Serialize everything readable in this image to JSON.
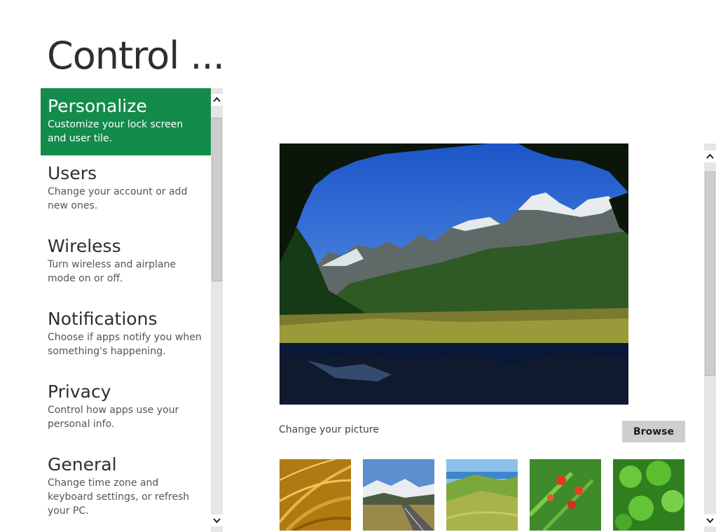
{
  "page": {
    "title": "Control ..."
  },
  "nav": {
    "items": [
      {
        "title": "Personalize",
        "desc": "Customize your lock screen and user tile.",
        "selected": true
      },
      {
        "title": "Users",
        "desc": "Change your account or add new ones."
      },
      {
        "title": "Wireless",
        "desc": "Turn wireless and airplane mode on or off."
      },
      {
        "title": "Notifications",
        "desc": "Choose if apps notify you when something's happening."
      },
      {
        "title": "Privacy",
        "desc": "Control how apps use your personal info."
      },
      {
        "title": "General",
        "desc": "Change time zone and keyboard settings, or refresh your PC."
      }
    ]
  },
  "picture": {
    "change_label": "Change your picture",
    "browse_label": "Browse",
    "thumbnails": [
      "golden-grass",
      "mountain-road",
      "coastal-hills",
      "red-flowers",
      "green-clover"
    ]
  },
  "colors": {
    "accent": "#138b4b",
    "scrollbar_track": "#e6e6e6",
    "button": "#cfcfcf"
  },
  "icons": {
    "scroll_up": "chevron-up-icon",
    "scroll_down": "chevron-down-icon"
  }
}
